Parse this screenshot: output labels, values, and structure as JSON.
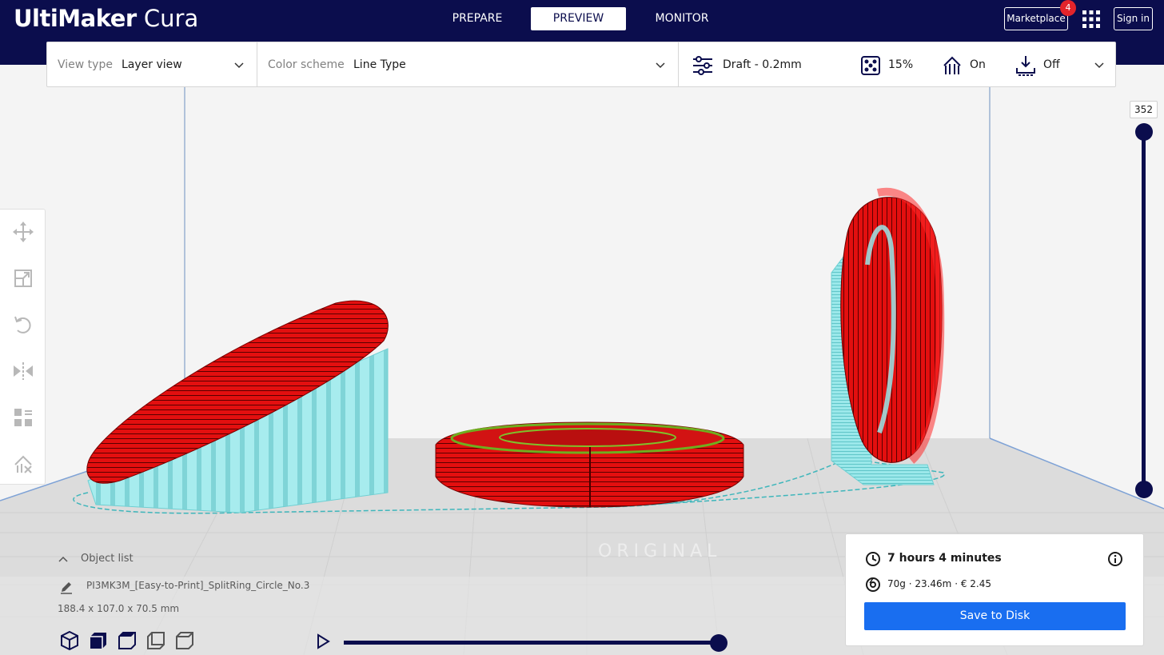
{
  "app": {
    "logo_bold": "UltiMaker",
    "logo_light": "Cura"
  },
  "stages": [
    {
      "label": "PREPARE",
      "active": false
    },
    {
      "label": "PREVIEW",
      "active": true
    },
    {
      "label": "MONITOR",
      "active": false
    }
  ],
  "header": {
    "marketplace_label": "Marketplace",
    "marketplace_badge": "4",
    "signin_label": "Sign in"
  },
  "toolbar": {
    "view_type_label": "View type",
    "view_type_value": "Layer view",
    "color_scheme_label": "Color scheme",
    "color_scheme_value": "Line Type",
    "profile": "Draft - 0.2mm",
    "infill": "15%",
    "support": "On",
    "adhesion": "Off"
  },
  "layer_slider": {
    "max_layer": "352",
    "current_layer": "352"
  },
  "tools": [
    "move-icon",
    "scale-icon",
    "rotate-icon",
    "mirror-icon",
    "per-model-settings-icon",
    "support-blocker-icon"
  ],
  "object_list": {
    "toggle_label": "Object list",
    "object_name": "PI3MK3M_[Easy-to-Print]_SplitRing_Circle_No.3",
    "dimensions": "188.4 x 107.0 x 70.5 mm"
  },
  "view_buttons": [
    "3d-view-icon",
    "front-view-icon",
    "top-view-icon",
    "left-view-icon",
    "right-view-icon"
  ],
  "simulation": {
    "progress": 1.0
  },
  "print_info": {
    "time": "7 hours 4 minutes",
    "material": "70g · 23.46m · € 2.45",
    "save_label": "Save to Disk"
  },
  "colors": {
    "header_bg": "#0b0d4d",
    "accent_blue": "#196ef0",
    "wall_red": "#e00d0d",
    "support_cyan": "#8be3e6",
    "badge_red": "#e3242b"
  }
}
